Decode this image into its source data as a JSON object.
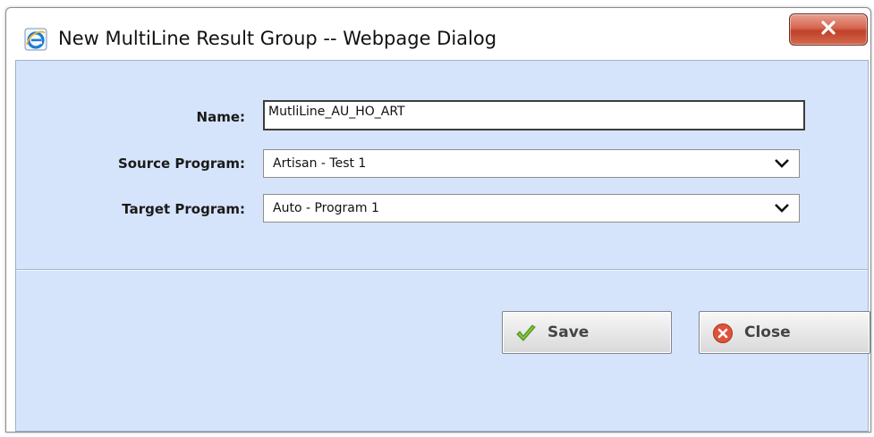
{
  "window": {
    "title": "New MultiLine Result Group -- Webpage Dialog",
    "close_icon": "close-x-icon",
    "app_icon": "internet-explorer-icon"
  },
  "form": {
    "name_label": "Name:",
    "name_value": "MutliLine_AU_HO_ART",
    "source_label": "Source Program:",
    "source_value": "Artisan - Test 1",
    "target_label": "Target Program:",
    "target_value": "Auto - Program 1"
  },
  "buttons": {
    "save_label": "Save",
    "save_icon": "checkmark-icon",
    "close_label": "Close",
    "close_icon": "close-circle-icon"
  },
  "colors": {
    "panel_background": "#d6e4fb",
    "close_button_red": "#c1402a"
  }
}
